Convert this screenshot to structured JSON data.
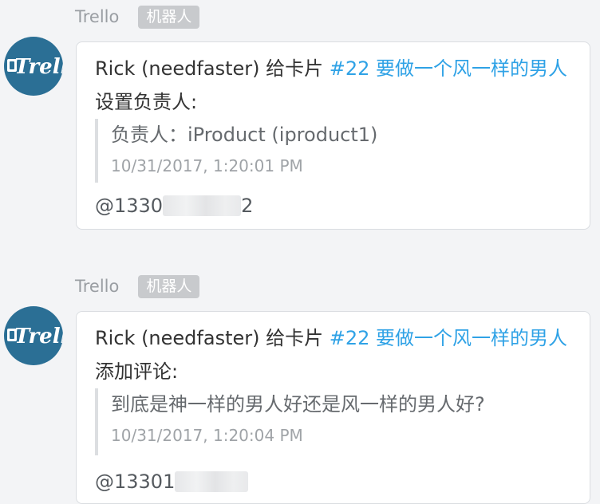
{
  "messages": [
    {
      "sender": "Trello",
      "badge": "机器人",
      "actor": "Rick (needfaster)",
      "verb": "给卡片",
      "card_link": "#22 要做一个风一样的男人",
      "action": "设置负责人:",
      "quote_text": "负责人：iProduct (iproduct1)",
      "timestamp": "10/31/2017, 1:20:01 PM",
      "mention_prefix": "@1330",
      "mention_suffix": "2"
    },
    {
      "sender": "Trello",
      "badge": "机器人",
      "actor": "Rick (needfaster)",
      "verb": "给卡片",
      "card_link": "#22 要做一个风一样的男人",
      "action": "添加评论:",
      "quote_text": "到底是神一样的男人好还是风一样的男人好?",
      "timestamp": "10/31/2017, 1:20:04 PM",
      "mention_prefix": "@13301",
      "mention_suffix": ""
    }
  ],
  "avatar_icon": "trello-logo",
  "colors": {
    "link": "#2fa2e6",
    "avatar_bg": "#2b6f95",
    "badge_bg": "#c8cacd",
    "page_bg": "#f3f4f6"
  }
}
